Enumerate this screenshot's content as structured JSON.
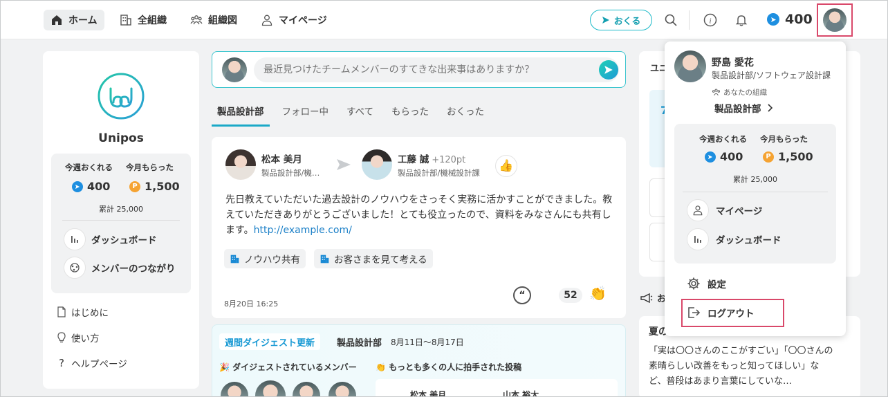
{
  "nav": {
    "home": "ホーム",
    "org": "全組織",
    "chart": "組織図",
    "mypage": "マイページ",
    "send": "おくる",
    "points": "400"
  },
  "left": {
    "brand": "Unipos",
    "week_send_label": "今週おくれる",
    "month_recv_label": "今月もらった",
    "week_send": "400",
    "month_recv": "1,500",
    "total": "累計 25,000",
    "dashboard": "ダッシュボード",
    "connections": "メンバーのつながり",
    "links": [
      "はじめに",
      "使い方",
      "ヘルプページ"
    ]
  },
  "composer": {
    "placeholder": "最近見つけたチームメンバーのすてきな出来事はありますか？"
  },
  "tabs": [
    "製品設計部",
    "フォロー中",
    "すべて",
    "もらった",
    "おくった"
  ],
  "post": {
    "sender_name": "松本 美月",
    "sender_dept": "製品設計部/機…",
    "receiver_name": "工藤 誠",
    "points": "+120pt",
    "receiver_dept": "製品設計部/機械設計課",
    "body": "先日教えていただいた過去設計のノウハウをさっそく実務に活かすことができました。教えていただきありがとうございました！とても役立ったので、資料をみなさんにも共有します。",
    "link": "http://example.com/",
    "tags": [
      "ノウハウ共有",
      "お客さまを見て考える"
    ],
    "date": "8月20日 16:25",
    "claps": "52"
  },
  "digest": {
    "tag": "週間ダイジェスト更新",
    "dept": "製品設計部",
    "range": "8月11日〜8月17日",
    "members_label": "🎉 ダイジェストされているメンバー",
    "top_label": "👏 もっとも多くの人に拍手された投稿",
    "top_sender": "松本 美月",
    "top_receiver": "山本 裕太"
  },
  "right": {
    "header": "ユニ",
    "card_char": "7",
    "announce": "お",
    "title": "夏の",
    "body": "「実は〇〇さんのここがすごい」「〇〇さんの素晴らしい改善をもっと知ってほしい」など、普段はあまり言葉にしていな…"
  },
  "dropdown": {
    "name": "野島 愛花",
    "dept": "製品設計部/ソフトウェア設計課",
    "org_label": "あなたの組織",
    "org": "製品設計部",
    "week_send_label": "今週おくれる",
    "month_recv_label": "今月もらった",
    "week_send": "400",
    "month_recv": "1,500",
    "total": "累計 25,000",
    "mypage": "マイページ",
    "dashboard": "ダッシュボード",
    "settings": "設定",
    "logout": "ログアウト"
  },
  "colors": {
    "accent": "#1aa9c7",
    "highlight": "#d9486a",
    "blue_point": "#1e8fe0",
    "orange_point": "#f5a332"
  }
}
